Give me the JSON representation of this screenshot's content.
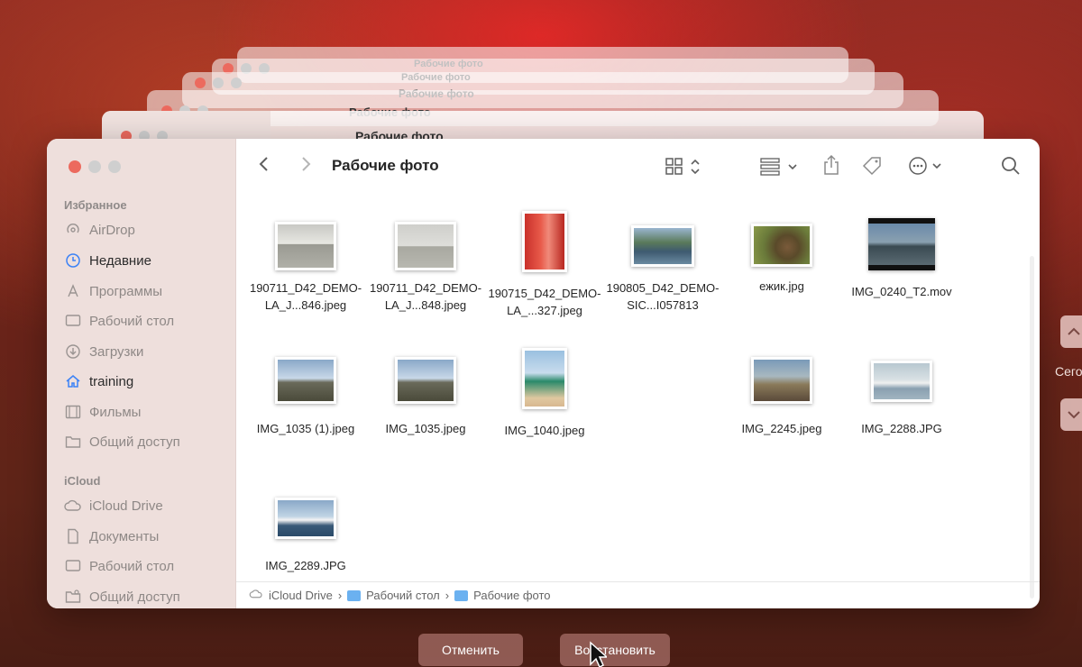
{
  "window": {
    "title": "Рабочие фото"
  },
  "sidebar": {
    "favorites_header": "Избранное",
    "favorites": [
      {
        "label": "AirDrop",
        "icon": "airdrop-icon"
      },
      {
        "label": "Недавние",
        "icon": "clock-icon",
        "active": true
      },
      {
        "label": "Программы",
        "icon": "apps-icon"
      },
      {
        "label": "Рабочий стол",
        "icon": "desktop-icon"
      },
      {
        "label": "Загрузки",
        "icon": "download-icon"
      },
      {
        "label": "training",
        "icon": "home-icon",
        "active": true
      },
      {
        "label": "Фильмы",
        "icon": "film-icon"
      },
      {
        "label": "Общий доступ",
        "icon": "folder-icon"
      }
    ],
    "icloud_header": "iCloud",
    "icloud": [
      {
        "label": "iCloud Drive",
        "icon": "cloud-icon"
      },
      {
        "label": "Документы",
        "icon": "document-icon"
      },
      {
        "label": "Рабочий стол",
        "icon": "desktop-icon"
      },
      {
        "label": "Общий доступ",
        "icon": "shared-folder-icon"
      }
    ]
  },
  "files": [
    {
      "name": "190711_D42_DEMO-LA_J...846.jpeg"
    },
    {
      "name": "190711_D42_DEMO-LA_J...848.jpeg"
    },
    {
      "name": "190715_D42_DEMO-LA_...327.jpeg"
    },
    {
      "name": "190805_D42_DEMO-SIC...I057813"
    },
    {
      "name": "ежик.jpg"
    },
    {
      "name": "IMG_0240_T2.mov"
    },
    {
      "name": "IMG_1035 (1).jpeg"
    },
    {
      "name": "IMG_1035.jpeg"
    },
    {
      "name": "IMG_1040.jpeg"
    },
    {
      "name": "IMG_2245.jpeg"
    },
    {
      "name": "IMG_2288.JPG"
    },
    {
      "name": "IMG_2289.JPG"
    }
  ],
  "pathbar": {
    "root": "iCloud Drive",
    "folder1": "Рабочий стол",
    "folder2": "Рабочие фото",
    "sep": "›"
  },
  "buttons": {
    "cancel": "Отменить",
    "restore": "Восстановить"
  },
  "side_label": "Сего",
  "colors": {
    "accent": "#3b82f6",
    "close": "#ec6a5e",
    "sidebar": "#eedfdc"
  }
}
